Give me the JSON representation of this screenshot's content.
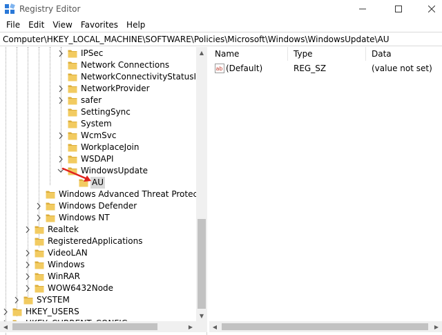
{
  "window": {
    "title": "Registry Editor",
    "icon": "registry-editor-icon",
    "controls": [
      "minimize-icon",
      "maximize-icon",
      "close-icon"
    ]
  },
  "menu": [
    "File",
    "Edit",
    "View",
    "Favorites",
    "Help"
  ],
  "address": "Computer\\HKEY_LOCAL_MACHINE\\SOFTWARE\\Policies\\Microsoft\\Windows\\WindowsUpdate\\AU",
  "tree": [
    {
      "label": "IPSec",
      "level": 3,
      "expander": "collapsed"
    },
    {
      "label": "Network Connections",
      "level": 3,
      "expander": "none"
    },
    {
      "label": "NetworkConnectivityStatusIndi",
      "level": 3,
      "expander": "none"
    },
    {
      "label": "NetworkProvider",
      "level": 3,
      "expander": "collapsed"
    },
    {
      "label": "safer",
      "level": 3,
      "expander": "collapsed"
    },
    {
      "label": "SettingSync",
      "level": 3,
      "expander": "none"
    },
    {
      "label": "System",
      "level": 3,
      "expander": "none"
    },
    {
      "label": "WcmSvc",
      "level": 3,
      "expander": "collapsed"
    },
    {
      "label": "WorkplaceJoin",
      "level": 3,
      "expander": "none"
    },
    {
      "label": "WSDAPI",
      "level": 3,
      "expander": "collapsed"
    },
    {
      "label": "WindowsUpdate",
      "level": 3,
      "expander": "expanded"
    },
    {
      "label": "AU",
      "level": 4,
      "expander": "none",
      "selected": true
    },
    {
      "label": "Windows Advanced Threat Protec",
      "level": 2,
      "expander": "none"
    },
    {
      "label": "Windows Defender",
      "level": 2,
      "expander": "collapsed"
    },
    {
      "label": "Windows NT",
      "level": 2,
      "expander": "collapsed"
    },
    {
      "label": "Realtek",
      "level": 1,
      "expander": "collapsed"
    },
    {
      "label": "RegisteredApplications",
      "level": 1,
      "expander": "none"
    },
    {
      "label": "VideoLAN",
      "level": 1,
      "expander": "collapsed"
    },
    {
      "label": "Windows",
      "level": 1,
      "expander": "collapsed"
    },
    {
      "label": "WinRAR",
      "level": 1,
      "expander": "collapsed"
    },
    {
      "label": "WOW6432Node",
      "level": 1,
      "expander": "collapsed"
    },
    {
      "label": "SYSTEM",
      "level": 0,
      "expander": "collapsed"
    },
    {
      "label": "HKEY_USERS",
      "level": -1,
      "expander": "collapsed"
    },
    {
      "label": "HKEY_CURRENT_CONFIG",
      "level": -1,
      "expander": "collapsed"
    }
  ],
  "columns": [
    "Name",
    "Type",
    "Data"
  ],
  "values": [
    {
      "name": "(Default)",
      "type": "REG_SZ",
      "data": "(value not set)",
      "icon": "string-value-icon"
    }
  ],
  "colors": {
    "folder": "#f2cb61",
    "folder_dark": "#dcae3b",
    "selection": "#d9d9d9",
    "annotation_arrow": "#e0231e"
  }
}
